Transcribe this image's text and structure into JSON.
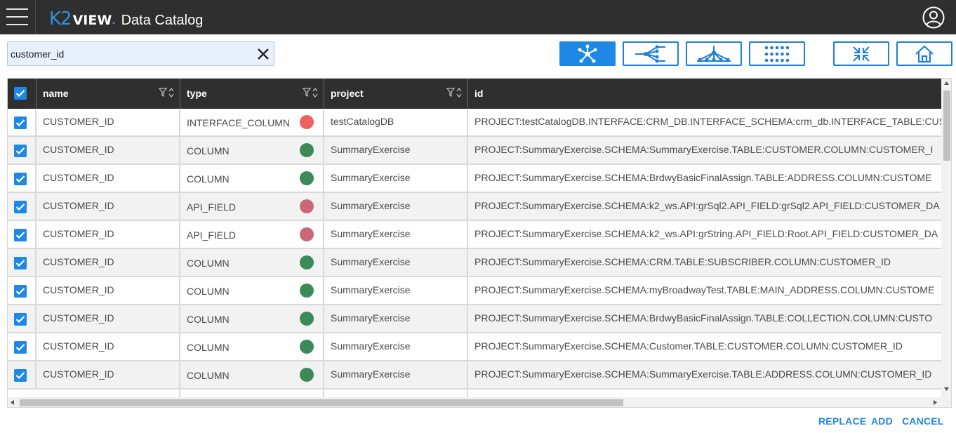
{
  "header": {
    "logo_k2": "K2",
    "logo_view": "VIEW",
    "logo_dot": ".",
    "app_title": "Data Catalog",
    "menu_icon": "hamburger-menu-icon",
    "user_icon": "user-account-icon"
  },
  "search": {
    "value": "customer_id",
    "clear_icon": "close-icon"
  },
  "toolbar": {
    "buttons": [
      {
        "icon": "star-network-icon",
        "active": true
      },
      {
        "icon": "tree-left-icon",
        "active": false
      },
      {
        "icon": "tree-down-icon",
        "active": false
      },
      {
        "icon": "dot-grid-icon",
        "active": false
      },
      {
        "icon": "collapse-icon",
        "active": false
      },
      {
        "icon": "home-icon",
        "active": false
      }
    ],
    "active_color": "#1e88e5"
  },
  "table": {
    "columns": [
      "name",
      "type",
      "project",
      "id"
    ],
    "rows": [
      {
        "name": "CUSTOMER_ID",
        "type": "INTERFACE_COLUMN",
        "status": "#f06060",
        "project": "testCatalogDB",
        "id": "PROJECT:testCatalogDB.INTERFACE:CRM_DB.INTERFACE_SCHEMA:crm_db.INTERFACE_TABLE:CUS"
      },
      {
        "name": "CUSTOMER_ID",
        "type": "COLUMN",
        "status": "#3c8a58",
        "project": "SummaryExercise",
        "id": "PROJECT:SummaryExercise.SCHEMA:SummaryExercise.TABLE:CUSTOMER.COLUMN:CUSTOMER_I"
      },
      {
        "name": "CUSTOMER_ID",
        "type": "COLUMN",
        "status": "#3c8a58",
        "project": "SummaryExercise",
        "id": "PROJECT:SummaryExercise.SCHEMA:BrdwyBasicFinalAssign.TABLE:ADDRESS.COLUMN:CUSTOME"
      },
      {
        "name": "CUSTOMER_ID",
        "type": "API_FIELD",
        "status": "#c86878",
        "project": "SummaryExercise",
        "id": "PROJECT:SummaryExercise.SCHEMA:k2_ws.API:grSql2.API_FIELD:grSql2.API_FIELD:CUSTOMER_DA"
      },
      {
        "name": "CUSTOMER_ID",
        "type": "API_FIELD",
        "status": "#c86878",
        "project": "SummaryExercise",
        "id": "PROJECT:SummaryExercise.SCHEMA:k2_ws.API:grString.API_FIELD:Root.API_FIELD:CUSTOMER_DA"
      },
      {
        "name": "CUSTOMER_ID",
        "type": "COLUMN",
        "status": "#3c8a58",
        "project": "SummaryExercise",
        "id": "PROJECT:SummaryExercise.SCHEMA:CRM.TABLE:SUBSCRIBER.COLUMN:CUSTOMER_ID"
      },
      {
        "name": "CUSTOMER_ID",
        "type": "COLUMN",
        "status": "#3c8a58",
        "project": "SummaryExercise",
        "id": "PROJECT:SummaryExercise.SCHEMA:myBroadwayTest.TABLE:MAIN_ADDRESS.COLUMN:CUSTOME"
      },
      {
        "name": "CUSTOMER_ID",
        "type": "COLUMN",
        "status": "#3c8a58",
        "project": "SummaryExercise",
        "id": "PROJECT:SummaryExercise.SCHEMA:BrdwyBasicFinalAssign.TABLE:COLLECTION.COLUMN:CUSTO"
      },
      {
        "name": "CUSTOMER_ID",
        "type": "COLUMN",
        "status": "#3c8a58",
        "project": "SummaryExercise",
        "id": "PROJECT:SummaryExercise.SCHEMA:Customer.TABLE:CUSTOMER.COLUMN:CUSTOMER_ID"
      },
      {
        "name": "CUSTOMER_ID",
        "type": "COLUMN",
        "status": "#3c8a58",
        "project": "SummaryExercise",
        "id": "PROJECT:SummaryExercise.SCHEMA:SummaryExercise.TABLE:ADDRESS.COLUMN:CUSTOMER_ID"
      }
    ]
  },
  "footer": {
    "replace_label": "REPLACE",
    "add_label": "ADD",
    "cancel_label": "CANCEL"
  }
}
